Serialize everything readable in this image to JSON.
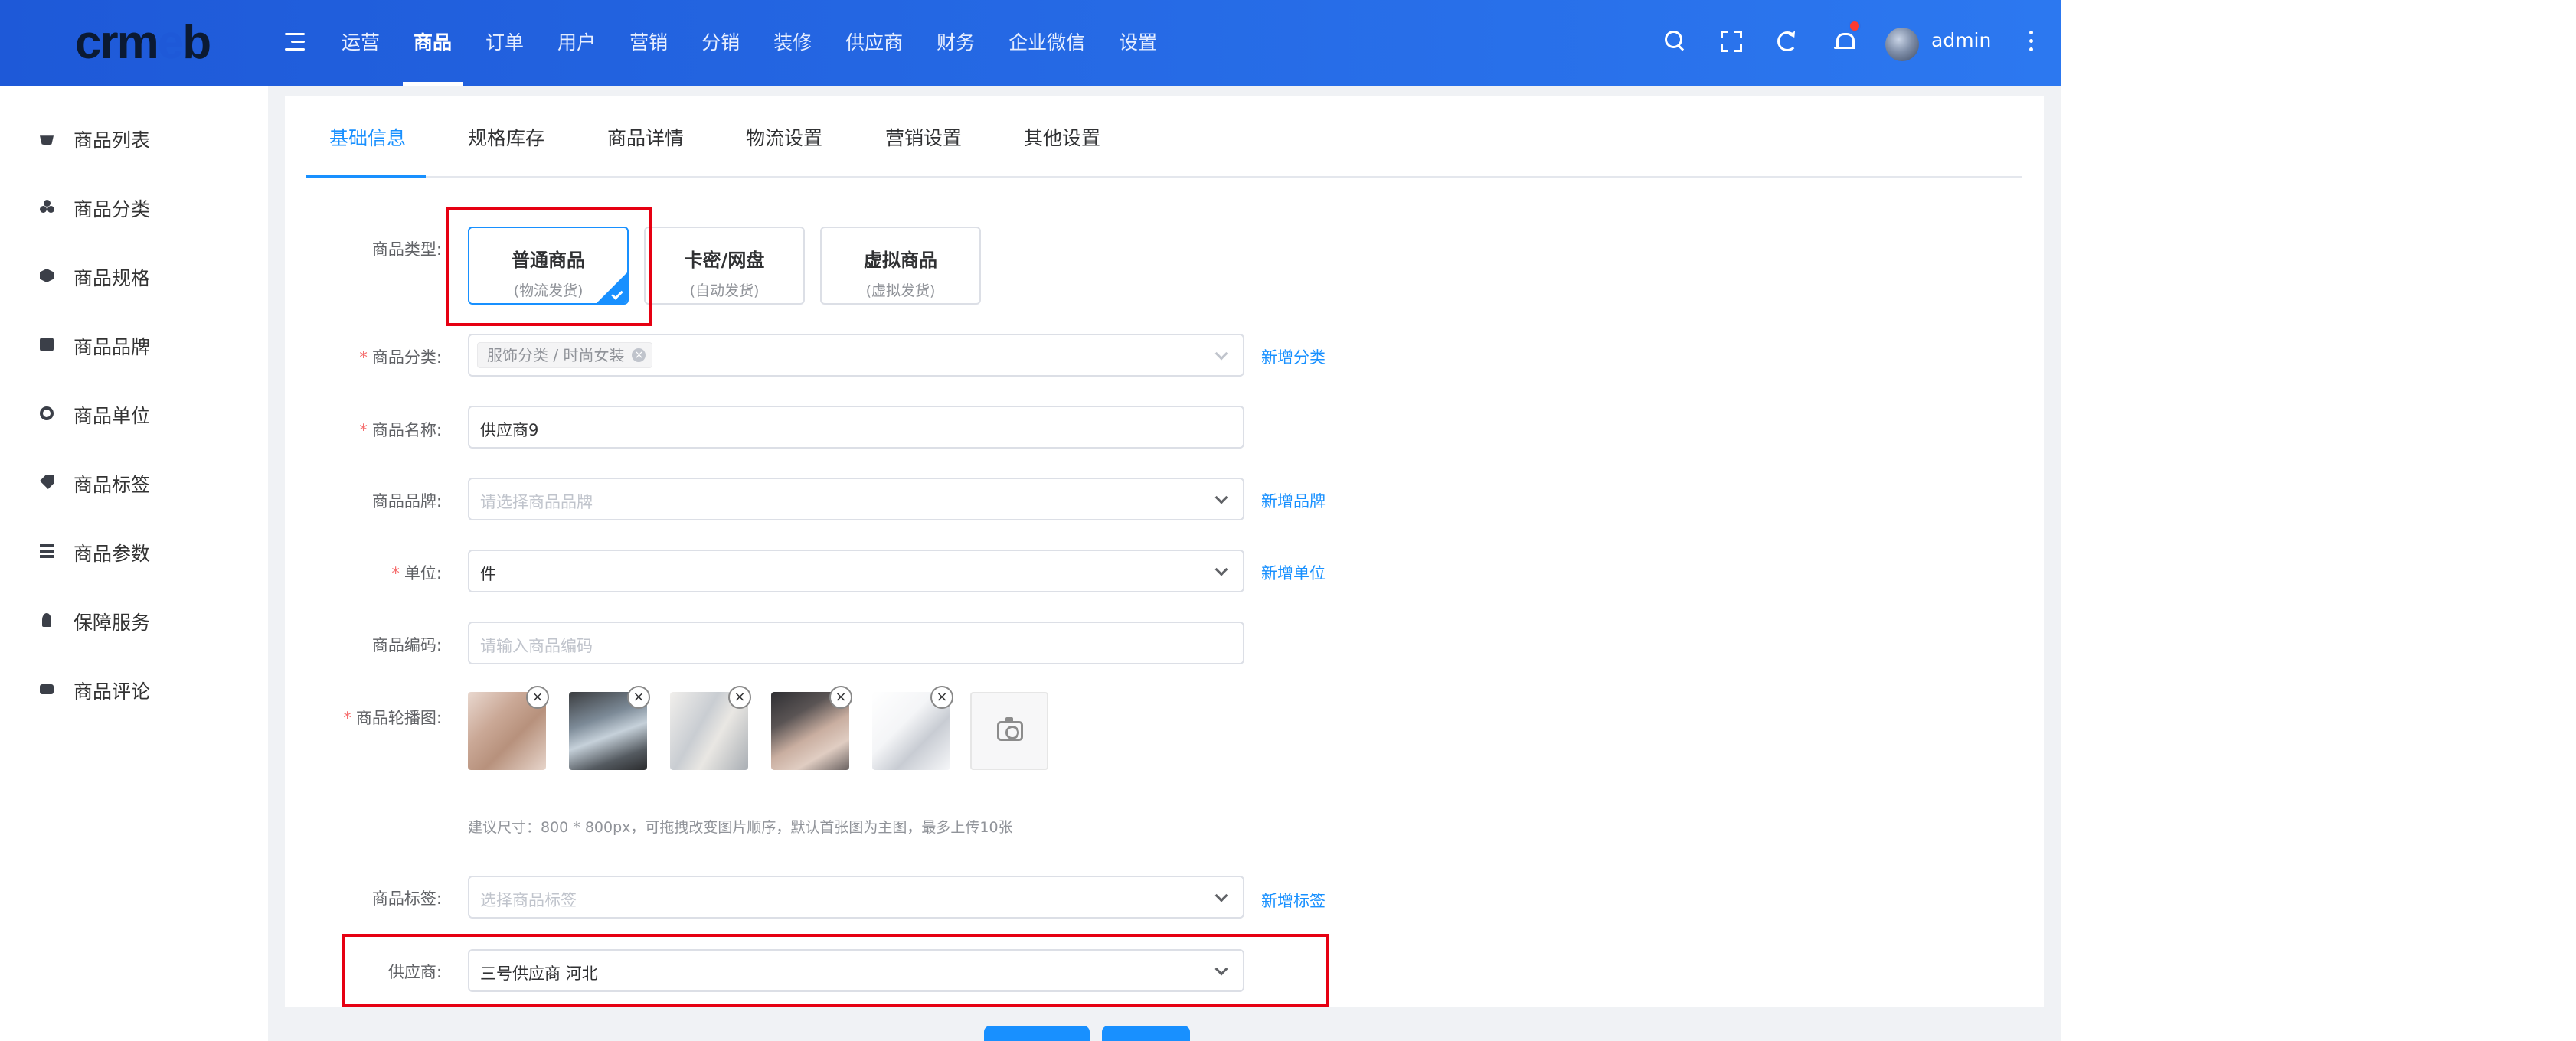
{
  "header": {
    "logo": "crmeb",
    "nav": [
      "运营",
      "商品",
      "订单",
      "用户",
      "营销",
      "分销",
      "装修",
      "供应商",
      "财务",
      "企业微信",
      "设置"
    ],
    "active_nav": "商品",
    "user_name": "admin",
    "colors": {
      "gradient_start": "#1e59d8",
      "gradient_end": "#2c78f0",
      "badge": "#ff3b30"
    }
  },
  "sidebar": {
    "items": [
      {
        "label": "商品列表",
        "icon": "basket-icon"
      },
      {
        "label": "商品分类",
        "icon": "category-icon"
      },
      {
        "label": "商品规格",
        "icon": "cube-icon"
      },
      {
        "label": "商品品牌",
        "icon": "brand-icon"
      },
      {
        "label": "商品单位",
        "icon": "unit-icon"
      },
      {
        "label": "商品标签",
        "icon": "tag-icon"
      },
      {
        "label": "商品参数",
        "icon": "param-icon"
      },
      {
        "label": "保障服务",
        "icon": "guard-icon"
      },
      {
        "label": "商品评论",
        "icon": "comment-icon"
      }
    ]
  },
  "tabs": [
    "基础信息",
    "规格库存",
    "商品详情",
    "物流设置",
    "营销设置",
    "其他设置"
  ],
  "active_tab": "基础信息",
  "form": {
    "type_label": "商品类型:",
    "types": [
      {
        "title": "普通商品",
        "sub": "(物流发货)",
        "selected": true
      },
      {
        "title": "卡密/网盘",
        "sub": "(自动发货)",
        "selected": false
      },
      {
        "title": "虚拟商品",
        "sub": "(虚拟发货)",
        "selected": false
      }
    ],
    "category": {
      "label": "商品分类:",
      "tag": "服饰分类 / 时尚女装",
      "link": "新增分类"
    },
    "name": {
      "label": "商品名称:",
      "value": "供应商9"
    },
    "brand": {
      "label": "商品品牌:",
      "placeholder": "请选择商品品牌",
      "link": "新增品牌"
    },
    "unit": {
      "label": "单位:",
      "value": "件",
      "link": "新增单位"
    },
    "code": {
      "label": "商品编码:",
      "placeholder": "请输入商品编码"
    },
    "images": {
      "label": "商品轮播图:",
      "count": 5,
      "hint": "建议尺寸：800 * 800px，可拖拽改变图片顺序，默认首张图为主图，最多上传10张"
    },
    "tags": {
      "label": "商品标签:",
      "placeholder": "选择商品标签",
      "link": "新增标签"
    },
    "supplier": {
      "label": "供应商:",
      "value": "三号供应商 河北"
    }
  },
  "accent_color": "#1890ff",
  "highlight_color": "#e60012"
}
